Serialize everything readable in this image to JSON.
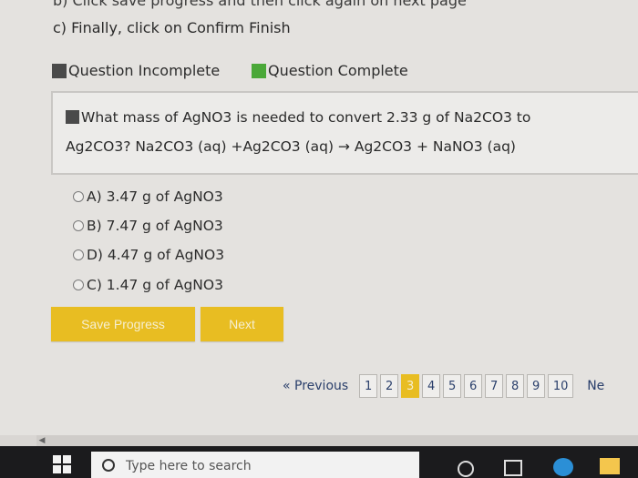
{
  "instructions": {
    "line_b": "b) Click save progress and then click again on next page",
    "line_c": "c) Finally, click on Confirm Finish"
  },
  "legend": {
    "incomplete_label": "Question Incomplete",
    "incomplete_color": "#4a4a4a",
    "complete_label": "Question Complete",
    "complete_color": "#4aa838"
  },
  "question": {
    "line1": "What mass of AgNO3 is needed to convert 2.33 g of Na2CO3 to",
    "line2": "Ag2CO3? Na2CO3 (aq) +Ag2CO3 (aq) → Ag2CO3 + NaNO3 (aq)"
  },
  "options": [
    {
      "label": "A) 3.47 g of AgNO3"
    },
    {
      "label": "B) 7.47 g of AgNO3"
    },
    {
      "label": "D) 4.47 g of AgNO3"
    },
    {
      "label": "C) 1.47 g of AgNO3"
    }
  ],
  "buttons": {
    "save_progress": "Save Progress",
    "next": "Next"
  },
  "pagination": {
    "previous": "« Previous",
    "pages": [
      "1",
      "2",
      "3",
      "4",
      "5",
      "6",
      "7",
      "8",
      "9",
      "10"
    ],
    "active_page": "3",
    "next": "Ne"
  },
  "taskbar": {
    "search_placeholder": "Type here to search"
  },
  "accent_color": "#e8bd22"
}
